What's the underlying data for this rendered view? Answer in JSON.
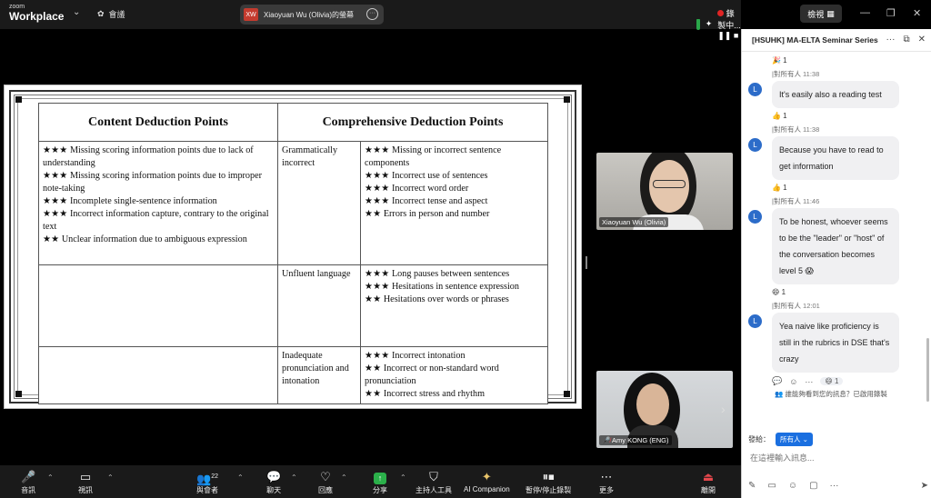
{
  "top_bar": {
    "logo_line1": "zoom",
    "logo_line2": "Workplace",
    "meeting_label": "會議",
    "share_badge": "XW",
    "share_title": "Xiaoyuan Wu (Olivia)的螢幕",
    "recording_status": "錄製中...",
    "view_label": "檢視"
  },
  "slide": {
    "header_left": "Content Deduction Points",
    "header_right": "Comprehensive Deduction Points",
    "content_points": [
      "★★★ Missing scoring information points due to lack of understanding",
      "★★★ Missing scoring information points due to improper note-taking",
      "★★★ Incomplete single-sentence information",
      "★★★ Incorrect information capture, contrary to the original text",
      "★★ Unclear information due to ambiguous expression"
    ],
    "categories": [
      {
        "name": "Grammatically incorrect",
        "points": [
          "★★★ Missing or incorrect sentence components",
          "★★★ Incorrect use of sentences",
          "★★★ Incorrect word order",
          "★★★ Incorrect tense and aspect",
          "★★ Errors in person and number"
        ]
      },
      {
        "name": "Unfluent language",
        "points": [
          "★★★ Long pauses between sentences",
          "★★★ Hesitations in sentence expression",
          "★★ Hesitations over words or phrases"
        ]
      },
      {
        "name": "Inadequate pronunciation and intonation",
        "points": [
          "★★★ Incorrect intonation",
          "★★ Incorrect or non-standard word pronunciation",
          "★★ Incorrect stress and rhythm"
        ]
      }
    ]
  },
  "videos": {
    "tile1_name": "Xiaoyuan Wu (Olivia)",
    "tile2_name": "Amy KONG (ENG)"
  },
  "chat": {
    "title": "[HSUHK] MA-ELTA Seminar Series",
    "top_reaction": "🎉 1",
    "messages": [
      {
        "to": "|對所有人",
        "time": "11:38",
        "avatar": "L",
        "text": "It's easily also a reading test",
        "reaction": "👍 1"
      },
      {
        "to": "|對所有人",
        "time": "11:38",
        "avatar": "L",
        "text": "Because you have to read to get information",
        "reaction": "👍 1"
      },
      {
        "to": "|對所有人",
        "time": "11:46",
        "avatar": "L",
        "text": "To be honest, whoever seems to be the \"leader\" or \"host\" of the conversation becomes level 5 😱",
        "reaction": "😄 1"
      },
      {
        "to": "|對所有人",
        "time": "12:01",
        "avatar": "L",
        "text": "Yea naive like proficiency is still in the rubrics in DSE that's crazy",
        "reaction": "😄 1"
      }
    ],
    "visibility_notice": "誰能夠看到您的訊息？已啟用錄製",
    "send_to_label": "發給：",
    "send_to_value": "所有人",
    "input_placeholder": "在這裡輸入訊息..."
  },
  "toolbar": {
    "audio": "音訊",
    "video": "視訊",
    "participants": "與會者",
    "participants_count": "22",
    "chat": "聊天",
    "react": "回應",
    "share": "分享",
    "host_tools": "主持人工具",
    "ai": "AI Companion",
    "record": "暫停/停止錄製",
    "more": "更多",
    "leave": "離開"
  }
}
